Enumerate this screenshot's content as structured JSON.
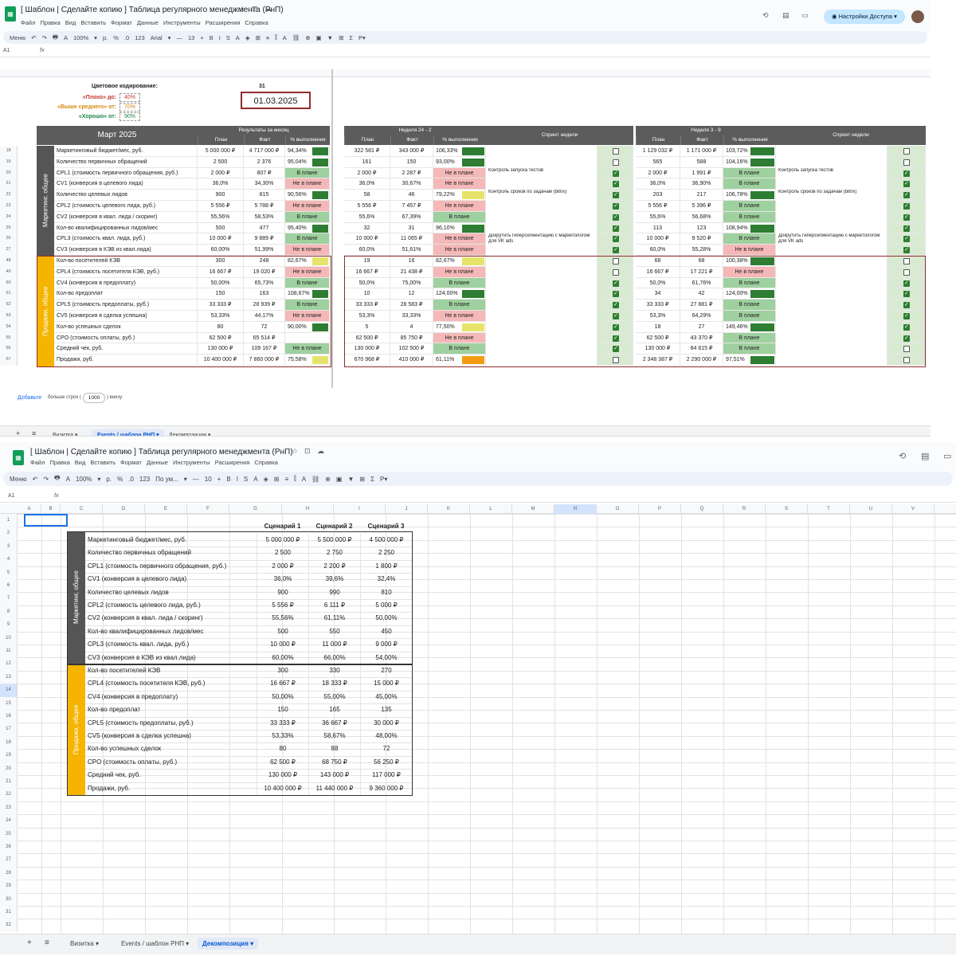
{
  "shot1": {
    "doc_title": "[ Шаблон | Сделайте копию ] Таблица регулярного менеджмента (РнП)",
    "menu": [
      "Файл",
      "Правка",
      "Вид",
      "Вставить",
      "Формат",
      "Данные",
      "Инструменты",
      "Расширения",
      "Справка"
    ],
    "toolbar": [
      "Меню",
      "↶",
      "↷",
      "🖶",
      "A",
      "100%",
      "▾",
      "р.",
      "%",
      ".0",
      "123",
      "Arial",
      "▾",
      "—",
      "13",
      "+",
      "B",
      "I",
      "S",
      "A",
      "◈",
      "⊞",
      "≡",
      "⫿",
      "A",
      "⛓",
      "⊕",
      "▣",
      "▼",
      "⊞",
      "Σ",
      "P▾"
    ],
    "share_label": "Настройки Доступа",
    "cell_ref": "A1",
    "fx": "fx",
    "legend_title": "Цветовое кодирование:",
    "legend_count": "31",
    "legend": [
      {
        "label": "«Плохо» до:",
        "value": "40%",
        "color": "#c0392b"
      },
      {
        "label": "«Выше среднего» от:",
        "value": "70%",
        "color": "#d68910"
      },
      {
        "label": "«Хорошо» от:",
        "value": "90%",
        "color": "#1e8449"
      }
    ],
    "date": "01.03.2025",
    "month_title": "Март 2025",
    "results_header": "Результаты за месяц",
    "week1_header": "Неделя 24 - 2",
    "week2_header": "Неделя 3 - 9",
    "sprint_header": "Спринт недели",
    "sub_headers": [
      "План",
      "Факт",
      "% выполнения"
    ],
    "side_marketing": "Маркетинг, общее",
    "side_sales": "Продажи, общее",
    "rows": [
      {
        "n": "18",
        "name": "Маркетинговый бюджет/мес, руб.",
        "p": "5 000 000 ₽",
        "f": "4 717 000 ₽",
        "pct": "94,34%",
        "bar": "#2e7d32",
        "w1p": "322 581 ₽",
        "w1f": "343 000 ₽",
        "w1pct": "106,33%",
        "w1bar": "#2e7d32",
        "w1chk": false,
        "w2p": "1 129 032 ₽",
        "w2f": "1 171 000 ₽",
        "w2pct": "103,72%",
        "w2bar": "#2e7d32",
        "w2chk": false,
        "sprint1": "",
        "sprint2": ""
      },
      {
        "n": "19",
        "name": "Количество первичных обращений",
        "p": "2 500",
        "f": "2 376",
        "pct": "95,04%",
        "bar": "#2e7d32",
        "w1p": "161",
        "w1f": "150",
        "w1pct": "93,00%",
        "w1bar": "#2e7d32",
        "w1chk": false,
        "w2p": "565",
        "w2f": "588",
        "w2pct": "104,16%",
        "w2bar": "#2e7d32",
        "w2chk": false,
        "sprint1": "",
        "sprint2": ""
      },
      {
        "n": "20",
        "name": "CPL1 (стоимость первичного обращения, руб.)",
        "p": "2 000 ₽",
        "f": "807 ₽",
        "pct": "В плане",
        "st": "green",
        "w1p": "2 000 ₽",
        "w1f": "2 287 ₽",
        "w1pct": "Не в плане",
        "w1st": "red",
        "w1chk": true,
        "w2p": "2 000 ₽",
        "w2f": "1 991 ₽",
        "w2pct": "В плане",
        "w2st": "green",
        "w2chk": true,
        "sprint1": "Контроль запуска тестов",
        "sprint2": "Контроль запуска тестов"
      },
      {
        "n": "21",
        "name": "CV1 (конверсия в целевого лида)",
        "p": "36,0%",
        "f": "34,30%",
        "pct": "Не в плане",
        "st": "red",
        "w1p": "36,0%",
        "w1f": "30,67%",
        "w1pct": "Не в плане",
        "w1st": "red",
        "w1chk": true,
        "w2p": "36,0%",
        "w2f": "36,90%",
        "w2pct": "В плане",
        "w2st": "green",
        "w2chk": true,
        "sprint1": "",
        "sprint2": ""
      },
      {
        "n": "22",
        "name": "Количество целевых лидов",
        "p": "900",
        "f": "815",
        "pct": "90,56%",
        "bar": "#2e7d32",
        "w1p": "58",
        "w1f": "46",
        "w1pct": "79,22%",
        "w1bar": "#e6e36a",
        "w1chk": true,
        "w2p": "203",
        "w2f": "217",
        "w2pct": "106,78%",
        "w2bar": "#2e7d32",
        "w2chk": true,
        "sprint1": "Контроль сроков по задачам (bitrix)",
        "sprint2": "Контроль сроков по задачам (bitrix)"
      },
      {
        "n": "23",
        "name": "CPL2 (стоимость целевого лида, руб.)",
        "p": "5 556 ₽",
        "f": "5 788 ₽",
        "pct": "Не в плане",
        "st": "red",
        "w1p": "5 556 ₽",
        "w1f": "7 457 ₽",
        "w1pct": "Не в плане",
        "w1st": "red",
        "w1chk": true,
        "w2p": "5 556 ₽",
        "w2f": "5 396 ₽",
        "w2pct": "В плане",
        "w2st": "green",
        "w2chk": true,
        "sprint1": "",
        "sprint2": ""
      },
      {
        "n": "24",
        "name": "CV2 (конверсия в квал. лида / скоринг)",
        "p": "55,56%",
        "f": "58,53%",
        "pct": "В плане",
        "st": "green",
        "w1p": "55,6%",
        "w1f": "67,39%",
        "w1pct": "В плане",
        "w1st": "green",
        "w1chk": true,
        "w2p": "55,6%",
        "w2f": "56,68%",
        "w2pct": "В плане",
        "w2st": "green",
        "w2chk": true,
        "sprint1": "",
        "sprint2": ""
      },
      {
        "n": "25",
        "name": "Кол-во квалифицированных лидов/мес",
        "p": "500",
        "f": "477",
        "pct": "95,40%",
        "bar": "#2e7d32",
        "w1p": "32",
        "w1f": "31",
        "w1pct": "96,10%",
        "w1bar": "#2e7d32",
        "w1chk": true,
        "w2p": "113",
        "w2f": "123",
        "w2pct": "108,94%",
        "w2bar": "#2e7d32",
        "w2chk": true,
        "sprint1": "",
        "sprint2": ""
      },
      {
        "n": "26",
        "name": "CPL3 (стоимость квал. лида, руб.)",
        "p": "10 000 ₽",
        "f": "9 889 ₽",
        "pct": "В плане",
        "st": "green",
        "w1p": "10 000 ₽",
        "w1f": "11 065 ₽",
        "w1pct": "Не в плане",
        "w1st": "red",
        "w1chk": true,
        "w2p": "10 000 ₽",
        "w2f": "9 520 ₽",
        "w2pct": "В плане",
        "w2st": "green",
        "w2chk": true,
        "sprint1": "Докрутить гиперсегментацию с маркетологом для VK ads",
        "sprint2": "Докрутить гиперсегментацию с маркетологом для VK ads"
      },
      {
        "n": "27",
        "name": "CV3 (конверсия в КЭВ из квал.лида)",
        "p": "60,00%",
        "f": "51,99%",
        "pct": "Не в плане",
        "st": "red",
        "w1p": "60,0%",
        "w1f": "51,61%",
        "w1pct": "Не в плане",
        "w1st": "red",
        "w1chk": true,
        "w2p": "60,0%",
        "w2f": "55,28%",
        "w2pct": "Не в плане",
        "w2st": "red",
        "w2chk": true,
        "sprint1": "",
        "sprint2": ""
      },
      {
        "n": "48",
        "name": "Кол-во посетителей КЭВ",
        "p": "300",
        "f": "248",
        "pct": "82,67%",
        "bar": "#e6e36a",
        "w1p": "19",
        "w1f": "16",
        "w1pct": "82,67%",
        "w1bar": "#e6e36a",
        "w1chk": false,
        "w2p": "68",
        "w2f": "68",
        "w2pct": "100,38%",
        "w2bar": "#2e7d32",
        "w2chk": false,
        "sprint1": "",
        "sprint2": ""
      },
      {
        "n": "49",
        "name": "CPL4 (стоимость посетителя КЭВ, руб.)",
        "p": "16 667 ₽",
        "f": "19 020 ₽",
        "pct": "Не в плане",
        "st": "red",
        "w1p": "16 667 ₽",
        "w1f": "21 438 ₽",
        "w1pct": "Не в плане",
        "w1st": "red",
        "w1chk": false,
        "w2p": "16 667 ₽",
        "w2f": "17 221 ₽",
        "w2pct": "Не в плане",
        "w2st": "red",
        "w2chk": false,
        "sprint1": "",
        "sprint2": ""
      },
      {
        "n": "50",
        "name": "CV4 (конверсия в предоплату)",
        "p": "50,00%",
        "f": "65,73%",
        "pct": "В плане",
        "st": "green",
        "w1p": "50,0%",
        "w1f": "75,00%",
        "w1pct": "В плане",
        "w1st": "green",
        "w1chk": true,
        "w2p": "50,0%",
        "w2f": "61,76%",
        "w2pct": "В плане",
        "w2st": "green",
        "w2chk": true,
        "sprint1": "",
        "sprint2": ""
      },
      {
        "n": "51",
        "name": "Кол-во предоплат",
        "p": "150",
        "f": "163",
        "pct": "108,67%",
        "bar": "#2e7d32",
        "w1p": "10",
        "w1f": "12",
        "w1pct": "124,00%",
        "w1bar": "#2e7d32",
        "w1chk": true,
        "w2p": "34",
        "w2f": "42",
        "w2pct": "124,00%",
        "w2bar": "#2e7d32",
        "w2chk": true,
        "sprint1": "",
        "sprint2": ""
      },
      {
        "n": "52",
        "name": "CPL5 (стоимость предоплаты, руб.)",
        "p": "33 333 ₽",
        "f": "28 939 ₽",
        "pct": "В плане",
        "st": "green",
        "w1p": "33 333 ₽",
        "w1f": "28 583 ₽",
        "w1pct": "В плане",
        "w1st": "green",
        "w1chk": true,
        "w2p": "33 333 ₽",
        "w2f": "27 881 ₽",
        "w2pct": "В плане",
        "w2st": "green",
        "w2chk": true,
        "sprint1": "",
        "sprint2": ""
      },
      {
        "n": "53",
        "name": "CV5 (конверсия в сделка успешна)",
        "p": "53,33%",
        "f": "44,17%",
        "pct": "Не в плане",
        "st": "red",
        "w1p": "53,3%",
        "w1f": "33,33%",
        "w1pct": "Не в плане",
        "w1st": "red",
        "w1chk": true,
        "w2p": "53,3%",
        "w2f": "64,29%",
        "w2pct": "В плане",
        "w2st": "green",
        "w2chk": true,
        "sprint1": "",
        "sprint2": ""
      },
      {
        "n": "54",
        "name": "Кол-во успешных сделок",
        "p": "80",
        "f": "72",
        "pct": "90,00%",
        "bar": "#2e7d32",
        "w1p": "5",
        "w1f": "4",
        "w1pct": "77,50%",
        "w1bar": "#e6e36a",
        "w1chk": true,
        "w2p": "18",
        "w2f": "27",
        "w2pct": "149,46%",
        "w2bar": "#2e7d32",
        "w2chk": true,
        "sprint1": "",
        "sprint2": ""
      },
      {
        "n": "55",
        "name": "CPO (стоимость оплаты, руб.)",
        "p": "62 500 ₽",
        "f": "65 514 ₽",
        "pct": "",
        "st": "",
        "w1p": "62 500 ₽",
        "w1f": "85 750 ₽",
        "w1pct": "Не в плане",
        "w1st": "red",
        "w1chk": true,
        "w2p": "62 500 ₽",
        "w2f": "43 370 ₽",
        "w2pct": "В плане",
        "w2st": "green",
        "w2chk": true,
        "sprint1": "",
        "sprint2": ""
      },
      {
        "n": "56",
        "name": "Средний чек, руб.",
        "p": "130 000 ₽",
        "f": "109 167 ₽",
        "pct": "Не в плане",
        "st": "green",
        "w1p": "130 000 ₽",
        "w1f": "102 500 ₽",
        "w1pct": "В плане",
        "w1st": "green",
        "w1chk": true,
        "w2p": "130 000 ₽",
        "w2f": "84 815 ₽",
        "w2pct": "В плане",
        "w2st": "green",
        "w2chk": false,
        "sprint1": "",
        "sprint2": ""
      },
      {
        "n": "57",
        "name": "Продажи, руб.",
        "p": "10 400 000 ₽",
        "f": "7 860 000 ₽",
        "pct": "75,58%",
        "bar": "#e6e36a",
        "w1p": "670 968 ₽",
        "w1f": "410 000 ₽",
        "w1pct": "61,11%",
        "w1bar": "#f39c12",
        "w1chk": false,
        "w2p": "2 348 387 ₽",
        "w2f": "2 290 000 ₽",
        "w2pct": "97,51%",
        "w2bar": "#2e7d32",
        "w2chk": false,
        "sprint1": "",
        "sprint2": ""
      }
    ],
    "add_label": "Добавьте",
    "add_more": "больше строк (",
    "add_count": "1000",
    "add_below": ") внизу",
    "tabs": [
      "Визитка ▾",
      "Events / шаблон РНП ▾",
      "Декомпозиция ▾"
    ],
    "active_tab": 1
  },
  "shot2": {
    "doc_title": "[ Шаблон | Сделайте копию ] Таблица регулярного менеджмента (РнП)",
    "menu": [
      "Файл",
      "Правка",
      "Вид",
      "Вставить",
      "Формат",
      "Данные",
      "Инструменты",
      "Расширения",
      "Справка"
    ],
    "toolbar": [
      "Меню",
      "↶",
      "↷",
      "🖶",
      "A",
      "100%",
      "▾",
      "р.",
      "%",
      ".0",
      "123",
      "По ум...",
      "▾",
      "—",
      "10",
      "+",
      "B",
      "I",
      "S",
      "A",
      "◈",
      "⊞",
      "≡",
      "⫿",
      "A",
      "⛓",
      "⊕",
      "▣",
      "▼",
      "⊞",
      "Σ",
      "P▾"
    ],
    "cell_ref": "A1",
    "fx": "fx",
    "columns": [
      "A",
      "B",
      "C",
      "D",
      "E",
      "F",
      "G",
      "H",
      "I",
      "J",
      "K",
      "L",
      "M",
      "N",
      "O",
      "P",
      "Q",
      "R",
      "S",
      "T",
      "U",
      "V"
    ],
    "scenario_headers": [
      "Сценарий 1",
      "Сценарий 2",
      "Сценарий 3"
    ],
    "side_marketing": "Маркетинг, общее",
    "side_sales": "Продажи, общее",
    "rows": [
      {
        "name": "Маркетинговый бюджет/мес, руб.",
        "v": [
          "5 000 000 ₽",
          "5 500 000 ₽",
          "4 500 000 ₽"
        ]
      },
      {
        "name": "Количество первичных обращений",
        "v": [
          "2 500",
          "2 750",
          "2 250"
        ]
      },
      {
        "name": "CPL1 (стоимость первичного обращения, руб.)",
        "v": [
          "2 000 ₽",
          "2 200 ₽",
          "1 800 ₽"
        ]
      },
      {
        "name": "CV1 (конверсия в целевого лида)",
        "v": [
          "36,0%",
          "39,6%",
          "32,4%"
        ]
      },
      {
        "name": "Количество целевых лидов",
        "v": [
          "900",
          "990",
          "810"
        ]
      },
      {
        "name": "CPL2 (стоимость целевого лида, руб.)",
        "v": [
          "5 556 ₽",
          "6 111 ₽",
          "5 000 ₽"
        ]
      },
      {
        "name": "CV2 (конверсия в квал. лида / скоринг)",
        "v": [
          "55,56%",
          "61,11%",
          "50,00%"
        ]
      },
      {
        "name": "Кол-во квалифицированных лидов/мес",
        "v": [
          "500",
          "550",
          "450"
        ]
      },
      {
        "name": "CPL3 (стоимость квал. лида, руб.)",
        "v": [
          "10 000 ₽",
          "11 000 ₽",
          "9 000 ₽"
        ]
      },
      {
        "name": "CV3 (конверсия в КЭВ из квал.лида)",
        "v": [
          "60,00%",
          "66,00%",
          "54,00%"
        ]
      },
      {
        "name": "Кол-во посетителей КЭВ",
        "v": [
          "300",
          "330",
          "270"
        ]
      },
      {
        "name": "CPL4 (стоимость посетителя КЭВ, руб.)",
        "v": [
          "16 667 ₽",
          "18 333 ₽",
          "15 000 ₽"
        ]
      },
      {
        "name": "CV4 (конверсия в предоплату)",
        "v": [
          "50,00%",
          "55,00%",
          "45,00%"
        ]
      },
      {
        "name": "Кол-во предоплат",
        "v": [
          "150",
          "165",
          "135"
        ]
      },
      {
        "name": "CPL5 (стоимость предоплаты, руб.)",
        "v": [
          "33 333 ₽",
          "36 667 ₽",
          "30 000 ₽"
        ]
      },
      {
        "name": "CV5 (конверсия в сделка успешна)",
        "v": [
          "53,33%",
          "58,67%",
          "48,00%"
        ]
      },
      {
        "name": "Кол-во успешных сделок",
        "v": [
          "80",
          "88",
          "72"
        ]
      },
      {
        "name": "CPO (стоимость оплаты, руб.)",
        "v": [
          "62 500 ₽",
          "68 750 ₽",
          "56 250 ₽"
        ]
      },
      {
        "name": "Средний чек, руб.",
        "v": [
          "130 000 ₽",
          "143 000 ₽",
          "117 000 ₽"
        ]
      },
      {
        "name": "Продажи, руб.",
        "v": [
          "10 400 000 ₽",
          "11 440 000 ₽",
          "9 360 000 ₽"
        ]
      }
    ],
    "tabs": [
      "Визитка ▾",
      "Events / шаблон РНП ▾",
      "Декомпозиция ▾"
    ],
    "active_tab": 2
  }
}
